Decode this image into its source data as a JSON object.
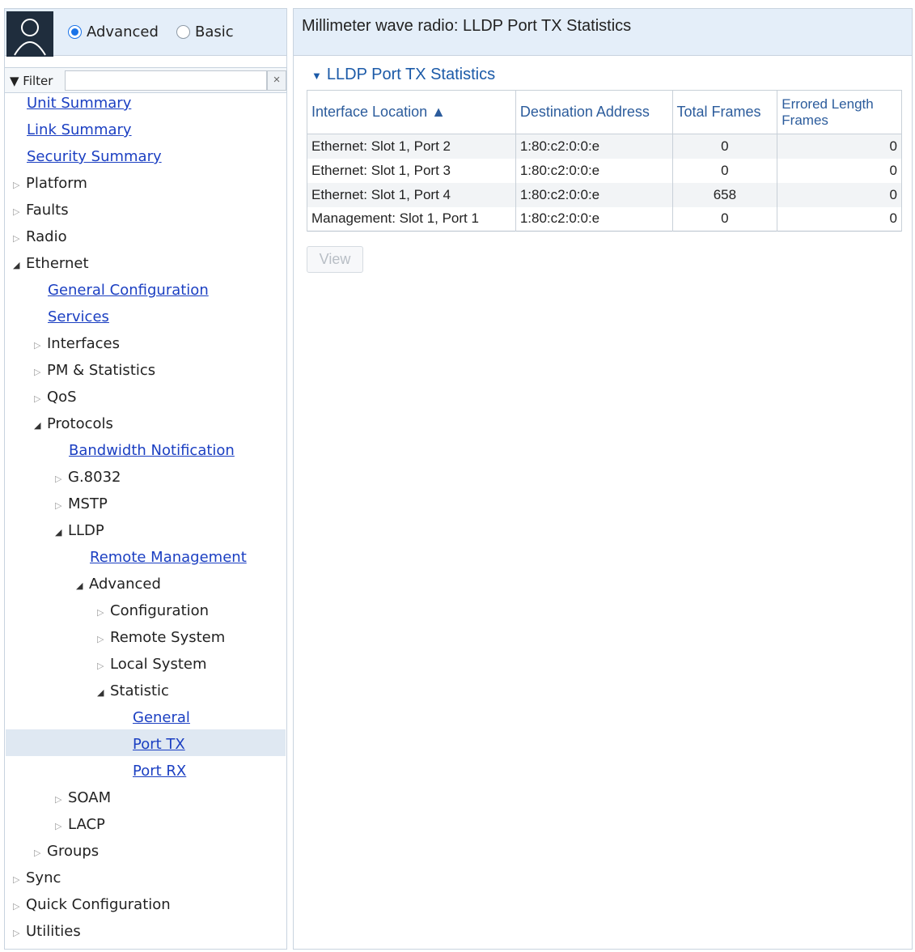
{
  "header": {
    "mode_options": [
      {
        "label": "Advanced",
        "selected": true
      },
      {
        "label": "Basic",
        "selected": false
      }
    ],
    "avatar_icon": "user-icon"
  },
  "filter": {
    "label": "▼ Filter",
    "value": "",
    "clear_symbol": "×"
  },
  "nav": {
    "unit_summary": "Unit Summary",
    "link_summary": "Link Summary",
    "security_summary": "Security Summary",
    "platform": "Platform",
    "faults": "Faults",
    "radio": "Radio",
    "ethernet": "Ethernet",
    "general_configuration": "General Configuration",
    "services": "Services",
    "interfaces": "Interfaces",
    "pm_statistics": "PM & Statistics",
    "qos": "QoS",
    "protocols": "Protocols",
    "bandwidth_notification": "Bandwidth Notification",
    "g8032": "G.8032",
    "mstp": "MSTP",
    "lldp": "LLDP",
    "remote_management": "Remote Management",
    "advanced": "Advanced",
    "configuration": "Configuration",
    "remote_system": "Remote System",
    "local_system": "Local System",
    "statistic": "Statistic",
    "general": "General",
    "port_tx": "Port TX",
    "port_rx": "Port RX",
    "soam": "SOAM",
    "lacp": "LACP",
    "groups": "Groups",
    "sync": "Sync",
    "quick_configuration": "Quick Configuration",
    "utilities": "Utilities",
    "selected_item": "Port TX"
  },
  "main": {
    "page_title": "Millimeter wave radio: LLDP Port TX Statistics",
    "section_title": "LLDP Port TX Statistics",
    "table": {
      "columns": [
        "Interface Location ▲",
        "Destination Address",
        "Total Frames",
        "Errored Length Frames"
      ],
      "rows": [
        [
          "Ethernet: Slot 1, Port 2",
          "1:80:c2:0:0:e",
          "0",
          "0"
        ],
        [
          "Ethernet: Slot 1, Port 3",
          "1:80:c2:0:0:e",
          "0",
          "0"
        ],
        [
          "Ethernet: Slot 1, Port 4",
          "1:80:c2:0:0:e",
          "658",
          "0"
        ],
        [
          "Management: Slot 1, Port 1",
          "1:80:c2:0:0:e",
          "0",
          "0"
        ]
      ]
    },
    "view_button": "View",
    "view_button_enabled": false
  },
  "colors": {
    "header_bg": "#e4eef9",
    "link": "#1b3fc2",
    "selected_row": "#dfe8f2",
    "radio_accent": "#1a73e8"
  }
}
